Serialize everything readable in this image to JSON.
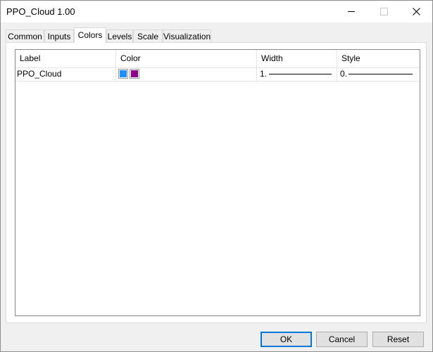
{
  "window": {
    "title": "PPO_Cloud 1.00"
  },
  "tabs": [
    {
      "label": "Common"
    },
    {
      "label": "Inputs"
    },
    {
      "label": "Colors",
      "active": true
    },
    {
      "label": "Levels"
    },
    {
      "label": "Scale"
    },
    {
      "label": "Visualization"
    }
  ],
  "table": {
    "columns": [
      "Label",
      "Color",
      "Width",
      "Style"
    ],
    "rows": [
      {
        "label": "PPO_Cloud",
        "colors": [
          "#1e90ff",
          "#8b008b"
        ],
        "width": "1.",
        "style": "0."
      }
    ]
  },
  "buttons": {
    "ok": "OK",
    "cancel": "Cancel",
    "reset": "Reset"
  }
}
